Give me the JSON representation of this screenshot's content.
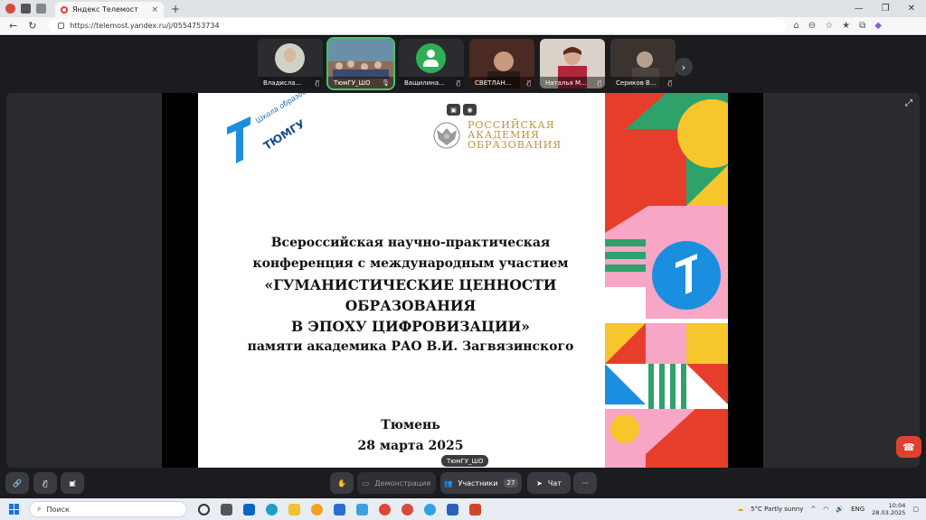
{
  "browser": {
    "tab_title": "Яндекс Телемост",
    "tab_close": "×",
    "new_tab": "+",
    "url": "https://telemost.yandex.ru/j/0554753734",
    "back": "←",
    "reload": "↻",
    "minimize": "—",
    "maximize": "❐",
    "close": "✕"
  },
  "participants": [
    {
      "name": "Владисла...",
      "mic": "muted"
    },
    {
      "name": "ТюмГУ_ШО",
      "mic": "on"
    },
    {
      "name": "Ващилина...",
      "mic": "muted"
    },
    {
      "name": "СВЕТЛАН...",
      "mic": "muted"
    },
    {
      "name": "Наталья М...",
      "mic": "muted"
    },
    {
      "name": "Сериков В...",
      "mic": "muted"
    }
  ],
  "participants_next": "›",
  "slide": {
    "logo_school": "Школа образования",
    "logo_univ": "ТЮМГУ",
    "rao_lines": [
      "РОССИЙСКАЯ",
      "АКАДЕМИЯ",
      "ОБРАЗОВАНИЯ"
    ],
    "conf_lines": [
      "Всероссийская научно-практическая",
      "конференция с международным участием",
      "«ГУМАНИСТИЧЕСКИЕ ЦЕННОСТИ",
      "ОБРАЗОВАНИЯ",
      "В ЭПОХУ ЦИФРОВИЗАЦИИ»",
      "памяти академика РАО В.И. Загвязинского"
    ],
    "city": "Тюмень",
    "date": "28 марта 2025"
  },
  "sharer_tag": "ТюмГУ_ШО",
  "toolbar": {
    "demo_label": "Демонстрация",
    "participants_label": "Участники",
    "participants_count": "27",
    "chat_label": "Чат",
    "more": "···"
  },
  "taskbar": {
    "search_placeholder": "Поиск",
    "weather": "5°C  Partly sunny",
    "lang": "ENG",
    "time": "10:04",
    "date": "28.03.2025"
  },
  "colors": {
    "accent_green": "#41c46a",
    "leave_red": "#e0412d",
    "rao_gold": "#b8963e",
    "tyumgu_blue": "#1a6fb8"
  }
}
